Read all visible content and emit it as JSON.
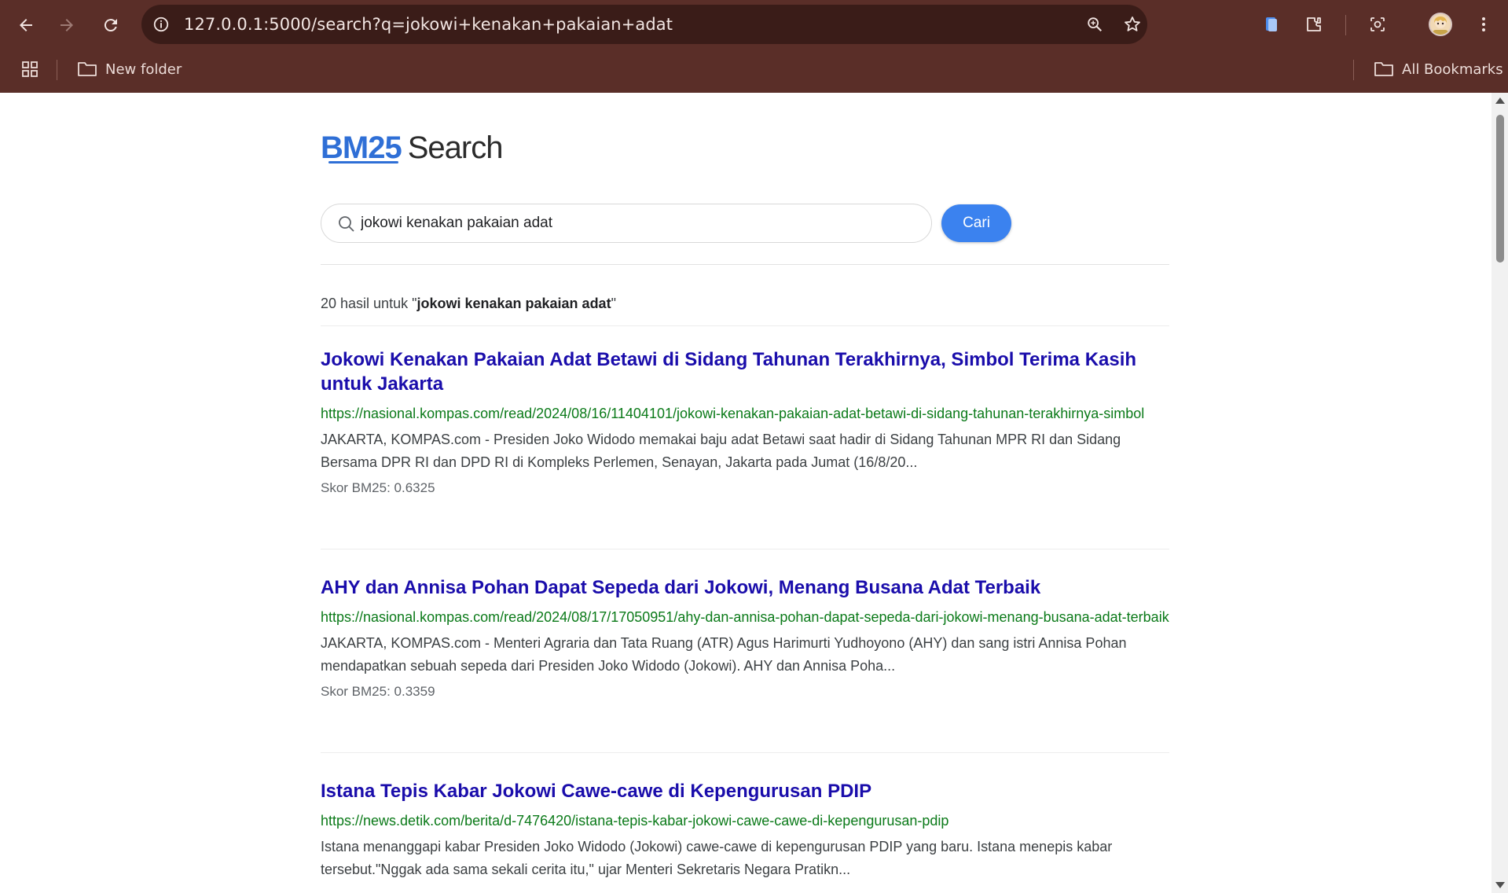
{
  "browser": {
    "url": "127.0.0.1:5000/search?q=jokowi+kenakan+pakaian+adat",
    "bookmarks": [
      {
        "label": "New folder"
      }
    ],
    "all_bookmarks_label": "All Bookmarks"
  },
  "page": {
    "logo": {
      "accent": "BM25",
      "rest": "Search"
    },
    "search": {
      "value": "jokowi kenakan pakaian adat",
      "button_label": "Cari"
    },
    "results_count": {
      "prefix": "20 hasil untuk \"",
      "query": "jokowi kenakan pakaian adat",
      "suffix": "\""
    },
    "results": [
      {
        "title": "Jokowi Kenakan Pakaian Adat Betawi di Sidang Tahunan Terakhirnya, Simbol Terima Kasih untuk Jakarta",
        "url": "https://nasional.kompas.com/read/2024/08/16/11404101/jokowi-kenakan-pakaian-adat-betawi-di-sidang-tahunan-terakhirnya-simbol",
        "snippet": "JAKARTA, KOMPAS.com - Presiden Joko Widodo memakai baju adat Betawi saat hadir di Sidang Tahunan MPR RI dan Sidang Bersama DPR RI dan DPD RI di Kompleks Perlemen, Senayan, Jakarta pada Jumat (16/8/20...",
        "score": "Skor BM25: 0.6325"
      },
      {
        "title": "AHY dan Annisa Pohan Dapat Sepeda dari Jokowi, Menang Busana Adat Terbaik",
        "url": "https://nasional.kompas.com/read/2024/08/17/17050951/ahy-dan-annisa-pohan-dapat-sepeda-dari-jokowi-menang-busana-adat-terbaik",
        "snippet": "JAKARTA, KOMPAS.com - Menteri Agraria dan Tata Ruang (ATR) Agus Harimurti Yudhoyono (AHY) dan sang istri Annisa Pohan mendapatkan sebuah sepeda dari Presiden Joko Widodo (Jokowi). AHY dan Annisa Poha...",
        "score": "Skor BM25: 0.3359"
      },
      {
        "title": "Istana Tepis Kabar Jokowi Cawe-cawe di Kepengurusan PDIP",
        "url": "https://news.detik.com/berita/d-7476420/istana-tepis-kabar-jokowi-cawe-cawe-di-kepengurusan-pdip",
        "snippet": "Istana menanggapi kabar Presiden Joko Widodo (Jokowi) cawe-cawe di kepengurusan PDIP yang baru. Istana menepis kabar tersebut.\"Nggak ada sama sekali cerita itu,\" ujar Menteri Sekretaris Negara Pratikn...",
        "score": ""
      }
    ]
  },
  "colors": {
    "chrome": "#5a2e28",
    "omnibox": "#3a1c18",
    "accent": "#3b82ef",
    "link": "#1a0dab",
    "url": "#0b7a19"
  },
  "icons": [
    "back-arrow-icon",
    "forward-arrow-icon",
    "reload-icon",
    "site-info-icon",
    "zoom-icon",
    "star-icon",
    "reading-list-icon",
    "extensions-icon",
    "screenshot-icon",
    "profile-avatar",
    "kebab-menu-icon",
    "apps-grid-icon",
    "folder-icon",
    "search-icon"
  ]
}
